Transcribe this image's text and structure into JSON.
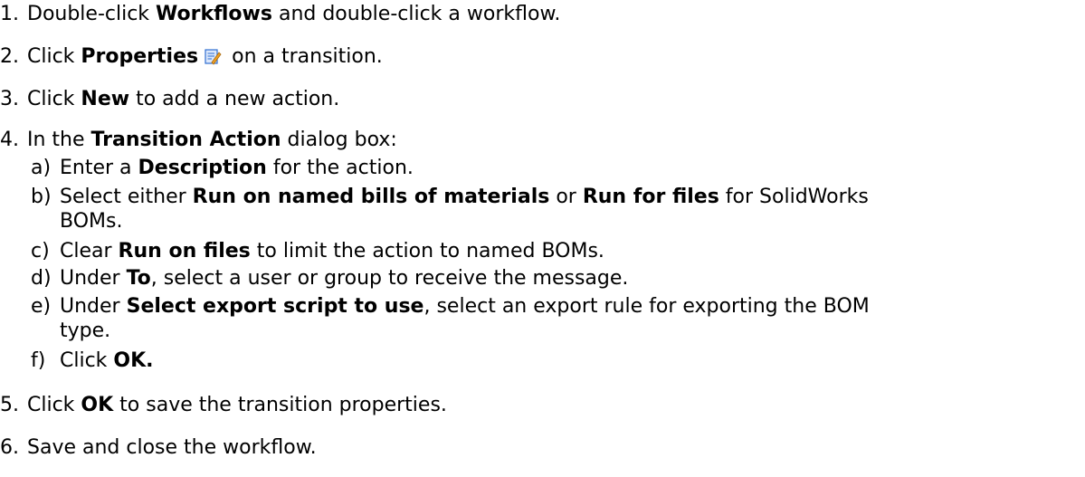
{
  "steps": [
    {
      "num": "1.",
      "parts": [
        "Double-click ",
        "Workflows",
        " and double-click a workflow."
      ]
    },
    {
      "num": "2.",
      "parts": [
        "Click ",
        "Properties",
        " on a transition."
      ],
      "icon": "properties-icon"
    },
    {
      "num": "3.",
      "parts": [
        "Click ",
        "New",
        " to add a new action."
      ]
    },
    {
      "num": "4.",
      "parts": [
        "In the ",
        "Transition Action",
        " dialog box:"
      ]
    },
    {
      "num": "5.",
      "parts": [
        "Click ",
        "OK",
        " to save the transition properties."
      ]
    },
    {
      "num": "6.",
      "parts": [
        "Save and close the workflow."
      ]
    }
  ],
  "substeps": [
    {
      "num": "a)",
      "parts": [
        "Enter a ",
        "Description",
        " for the action."
      ]
    },
    {
      "num": "b)",
      "parts": [
        "Select either ",
        "Run on named bills of materials",
        " or ",
        "Run for files",
        " for SolidWorks"
      ],
      "cont": "BOMs."
    },
    {
      "num": "c)",
      "parts": [
        "Clear ",
        "Run on files",
        " to limit the action to named BOMs."
      ]
    },
    {
      "num": "d)",
      "parts": [
        "Under ",
        "To",
        ", select a user or group to receive the message."
      ]
    },
    {
      "num": "e)",
      "parts": [
        "Under ",
        "Select export script to use",
        ", select an export rule for exporting the BOM"
      ],
      "cont": "type."
    },
    {
      "num": "f)",
      "parts": [
        "Click ",
        "OK."
      ]
    }
  ],
  "colors": {
    "text": "#000000",
    "background": "#ffffff",
    "icon_blue": "#2f6fd0",
    "icon_orange": "#f0a020"
  }
}
